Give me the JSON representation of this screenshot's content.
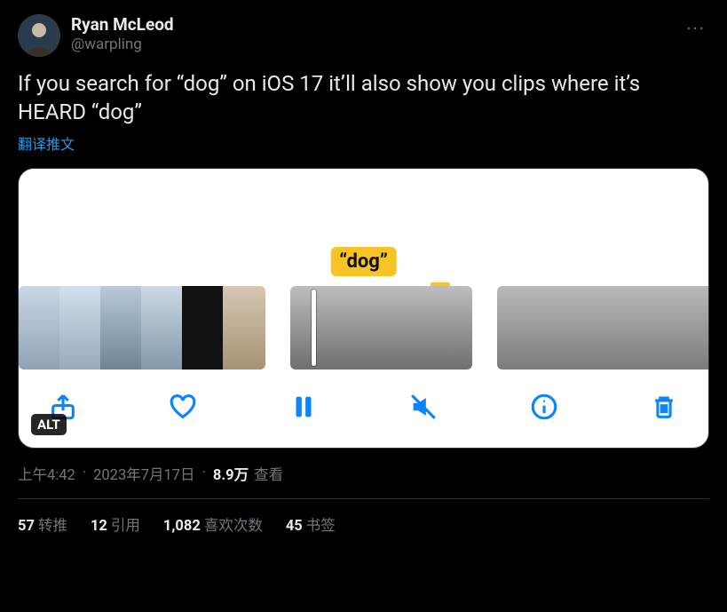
{
  "author": {
    "display_name": "Ryan McLeod",
    "handle": "@warpling"
  },
  "body": "If you search for “dog” on iOS 17 it’ll also show you clips where it’s HEARD “dog”",
  "translate_label": "翻译推文",
  "media": {
    "caption_text": "“dog”",
    "alt_badge": "ALT",
    "toolbar_icons": [
      "share",
      "heart",
      "pause",
      "mute",
      "info",
      "trash"
    ]
  },
  "meta": {
    "time": "上午4:42",
    "date": "2023年7月17日",
    "views_number": "8.9万",
    "views_label": "查看"
  },
  "stats": {
    "retweets": {
      "count": "57",
      "label": "转推"
    },
    "quotes": {
      "count": "12",
      "label": "引用"
    },
    "likes": {
      "count": "1,082",
      "label": "喜欢次数"
    },
    "bookmarks": {
      "count": "45",
      "label": "书签"
    }
  }
}
